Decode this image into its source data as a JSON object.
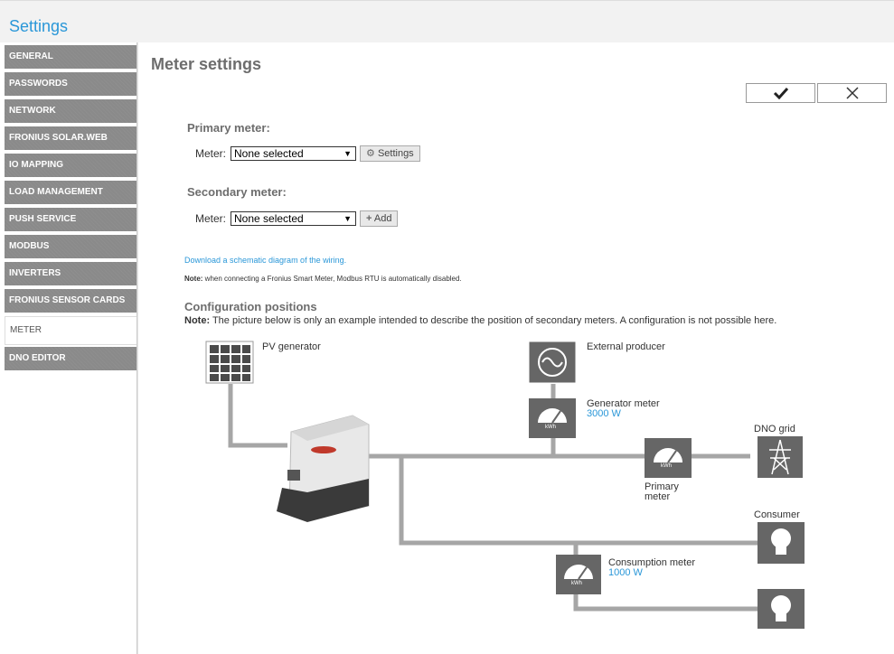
{
  "app": {
    "title": "Settings"
  },
  "sidebar": {
    "items": [
      {
        "label": "GENERAL"
      },
      {
        "label": "PASSWORDS"
      },
      {
        "label": "NETWORK"
      },
      {
        "label": "FRONIUS SOLAR.WEB"
      },
      {
        "label": "IO MAPPING"
      },
      {
        "label": "LOAD MANAGEMENT"
      },
      {
        "label": "PUSH SERVICE"
      },
      {
        "label": "MODBUS"
      },
      {
        "label": "INVERTERS"
      },
      {
        "label": "FRONIUS SENSOR CARDS"
      },
      {
        "label": "METER",
        "active": true
      },
      {
        "label": "DNO EDITOR"
      }
    ]
  },
  "main": {
    "title": "Meter settings",
    "confirm_icon": "checkmark-icon",
    "cancel_icon": "close-icon",
    "primary": {
      "title": "Primary meter:",
      "meter_label": "Meter:",
      "selected": "None selected",
      "button_label": "Settings",
      "button_icon": "gear-icon"
    },
    "secondary": {
      "title": "Secondary meter:",
      "meter_label": "Meter:",
      "selected": "None selected",
      "button_label": "Add",
      "button_icon": "plus-icon"
    },
    "download_link": "Download a schematic diagram of the wiring.",
    "note_prefix": "Note:",
    "note_text": " when connecting a Fronius Smart Meter, Modbus RTU is automatically disabled.",
    "config_title": "Configuration positions",
    "config_note_prefix": "Note:",
    "config_note_text": " The picture below is only an example intended to describe the position of secondary meters. A configuration is not possible here."
  },
  "diagram": {
    "pv_generator": "PV generator",
    "external_producer": "External producer",
    "generator_meter": "Generator meter",
    "generator_value": "3000 W",
    "dno_grid": "DNO grid",
    "primary_meter_line1": "Primary",
    "primary_meter_line2": "meter",
    "consumer": "Consumer",
    "consumption_meter": "Consumption meter",
    "consumption_value": "1000 W",
    "meter_unit": "kWh",
    "colors": {
      "wire": "#a6a6a6",
      "icon_bg": "#666666",
      "accent": "#2a97d8"
    }
  }
}
